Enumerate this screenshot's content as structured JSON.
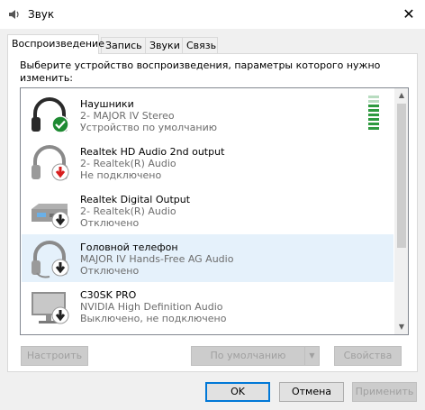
{
  "window": {
    "title": "Звук",
    "close_glyph": "✕"
  },
  "tabs": [
    {
      "label": "Воспроизведение",
      "active": true
    },
    {
      "label": "Запись",
      "active": false
    },
    {
      "label": "Звуки",
      "active": false
    },
    {
      "label": "Связь",
      "active": false
    }
  ],
  "instruction": "Выберите устройство воспроизведения, параметры которого нужно изменить:",
  "devices": [
    {
      "name": "Наушники",
      "driver": "2- MAJOR IV Stereo",
      "status": "Устройство по умолчанию",
      "icon": "headphones-icon",
      "badge": "default-check-icon",
      "selected": false,
      "level_bars": 8,
      "lit_bars": 6
    },
    {
      "name": "Realtek HD Audio 2nd output",
      "driver": "2- Realtek(R) Audio",
      "status": "Не подключено",
      "icon": "headphones-icon",
      "badge": "not-connected-red-arrow-icon",
      "selected": false
    },
    {
      "name": "Realtek Digital Output",
      "driver": "2- Realtek(R) Audio",
      "status": "Отключено",
      "icon": "digital-output-icon",
      "badge": "disabled-arrow-icon",
      "selected": false
    },
    {
      "name": "Головной телефон",
      "driver": "MAJOR IV Hands-Free AG Audio",
      "status": "Отключено",
      "icon": "headset-icon",
      "badge": "disabled-arrow-icon",
      "selected": true
    },
    {
      "name": "C30SK PRO",
      "driver": "NVIDIA High Definition Audio",
      "status": "Выключено, не подключено",
      "icon": "monitor-icon",
      "badge": "disabled-arrow-icon",
      "selected": false
    }
  ],
  "buttons": {
    "configure": "Настроить",
    "set_default": "По умолчанию",
    "properties": "Свойства",
    "ok": "OK",
    "cancel": "Отмена",
    "apply": "Применить"
  },
  "colors": {
    "accent": "#0078d7",
    "selected_row": "#e5f1fb",
    "vu_lit": "#2e9a3f",
    "vu_unlit": "#b8dcc0",
    "check_green": "#1e8a32",
    "not_connected_red": "#d81e1e"
  }
}
